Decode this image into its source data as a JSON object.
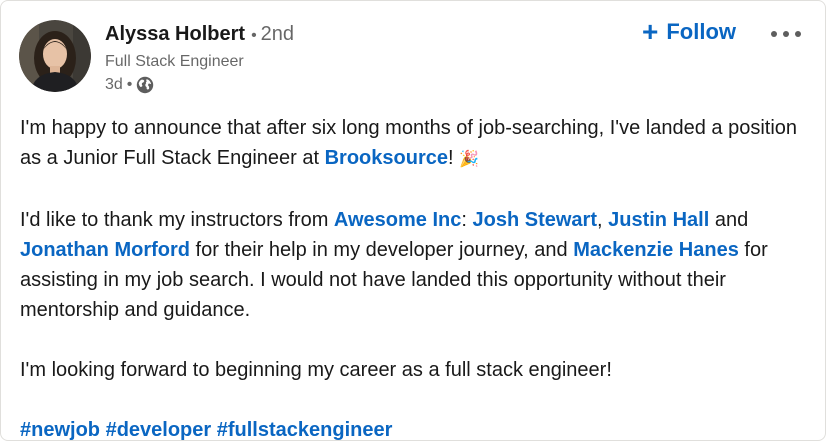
{
  "author": {
    "name": "Alyssa Holbert",
    "separator": "•",
    "degree": "2nd",
    "headline": "Full Stack Engineer",
    "timestamp": "3d",
    "meta_separator": "•",
    "visibility_icon": "globe-icon"
  },
  "actions": {
    "follow_plus": "+",
    "follow_label": "Follow",
    "more_icon": "more-horizontal-icon"
  },
  "post": {
    "p1_a": "I'm happy to announce that after six long months of job-searching, I've landed a position as a Junior Full Stack Engineer at ",
    "company": "Brooksource",
    "p1_b": "! ",
    "p1_emoji": "🎉",
    "p2_a": "I'd like to thank my instructors from ",
    "org": "Awesome Inc",
    "p2_b": ": ",
    "instructor1": "Josh Stewart",
    "p2_c": ", ",
    "instructor2": "Justin Hall",
    "p2_d": " and ",
    "instructor3": "Jonathan Morford",
    "p2_e": " for their help in my developer journey, and ",
    "helper": "Mackenzie Hanes",
    "p2_f": " for assisting in my job search. I would not have landed this opportunity without their mentorship and guidance.",
    "p3": "I'm looking forward to beginning my career as a full stack engineer!",
    "hashtags": [
      "#newjob",
      "#developer",
      "#fullstackengineer"
    ]
  },
  "colors": {
    "link": "#0a66c2",
    "text_primary": "#191919",
    "text_secondary": "#666666"
  }
}
